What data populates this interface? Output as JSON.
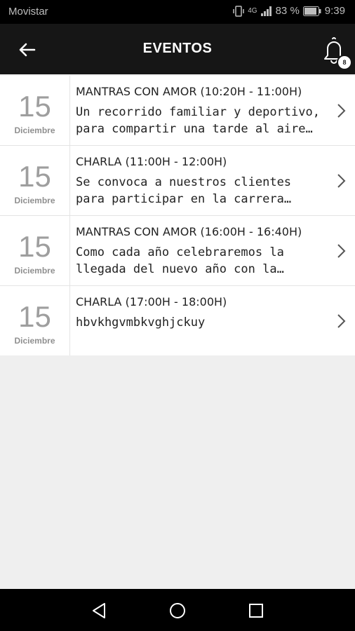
{
  "status_bar": {
    "carrier": "Movistar",
    "network": "4G",
    "battery": "83 %",
    "time": "9:39"
  },
  "header": {
    "title": "EVENTOS",
    "notification_count": "8"
  },
  "events": [
    {
      "day": "15",
      "month": "Diciembre",
      "title": "MANTRAS CON AMOR (10:20H -  11:00H)",
      "description": "Un recorrido familiar y deportivo, para compartir una tarde al aire libre, es la ocasión perfecta"
    },
    {
      "day": "15",
      "month": "Diciembre",
      "title": "CHARLA (11:00H - 12:00H)",
      "description": "Se convoca a nuestros clientes para participar en la carrera nocturna que se celebrará"
    },
    {
      "day": "15",
      "month": "Diciembre",
      "title": "MANTRAS CON AMOR (16:00H -  16:40H)",
      "description": "Como cada año celebraremos la llegada del nuevo año con la organización"
    },
    {
      "day": "15",
      "month": "Diciembre",
      "title": "CHARLA (17:00H - 18:00H)",
      "description": "hbvkhgvmbkvghjckuy"
    }
  ],
  "icons": {
    "back": "arrow-left-icon",
    "bell": "bell-icon",
    "chevron": "chevron-right-icon",
    "nav_back": "triangle-back-icon",
    "nav_home": "circle-home-icon",
    "nav_recents": "square-recents-icon"
  },
  "colors": {
    "app_bar": "#161616",
    "background": "#efefef",
    "date_text": "#9e9e9e"
  }
}
